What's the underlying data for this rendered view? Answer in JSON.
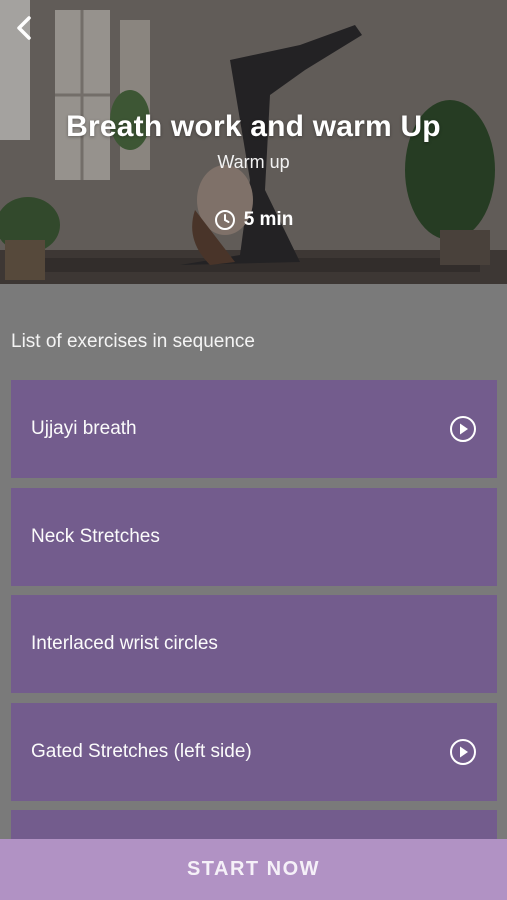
{
  "header": {
    "title": "Breath work and warm Up",
    "subtitle": "Warm up",
    "duration": "5 min",
    "back_icon": "chevron-left-icon",
    "clock_icon": "clock-icon"
  },
  "section": {
    "label": "List of exercises in sequence"
  },
  "exercises": [
    {
      "label": "Ujjayi breath",
      "has_play": true
    },
    {
      "label": "Neck Stretches",
      "has_play": false
    },
    {
      "label": "Interlaced wrist circles",
      "has_play": false
    },
    {
      "label": "Gated Stretches (left side)",
      "has_play": true
    },
    {
      "label": "",
      "has_play": false
    }
  ],
  "footer": {
    "start_label": "START NOW"
  },
  "colors": {
    "item_bg": "#735c8d",
    "start_bg": "#b192c4",
    "page_bg": "#7a7a7a"
  }
}
